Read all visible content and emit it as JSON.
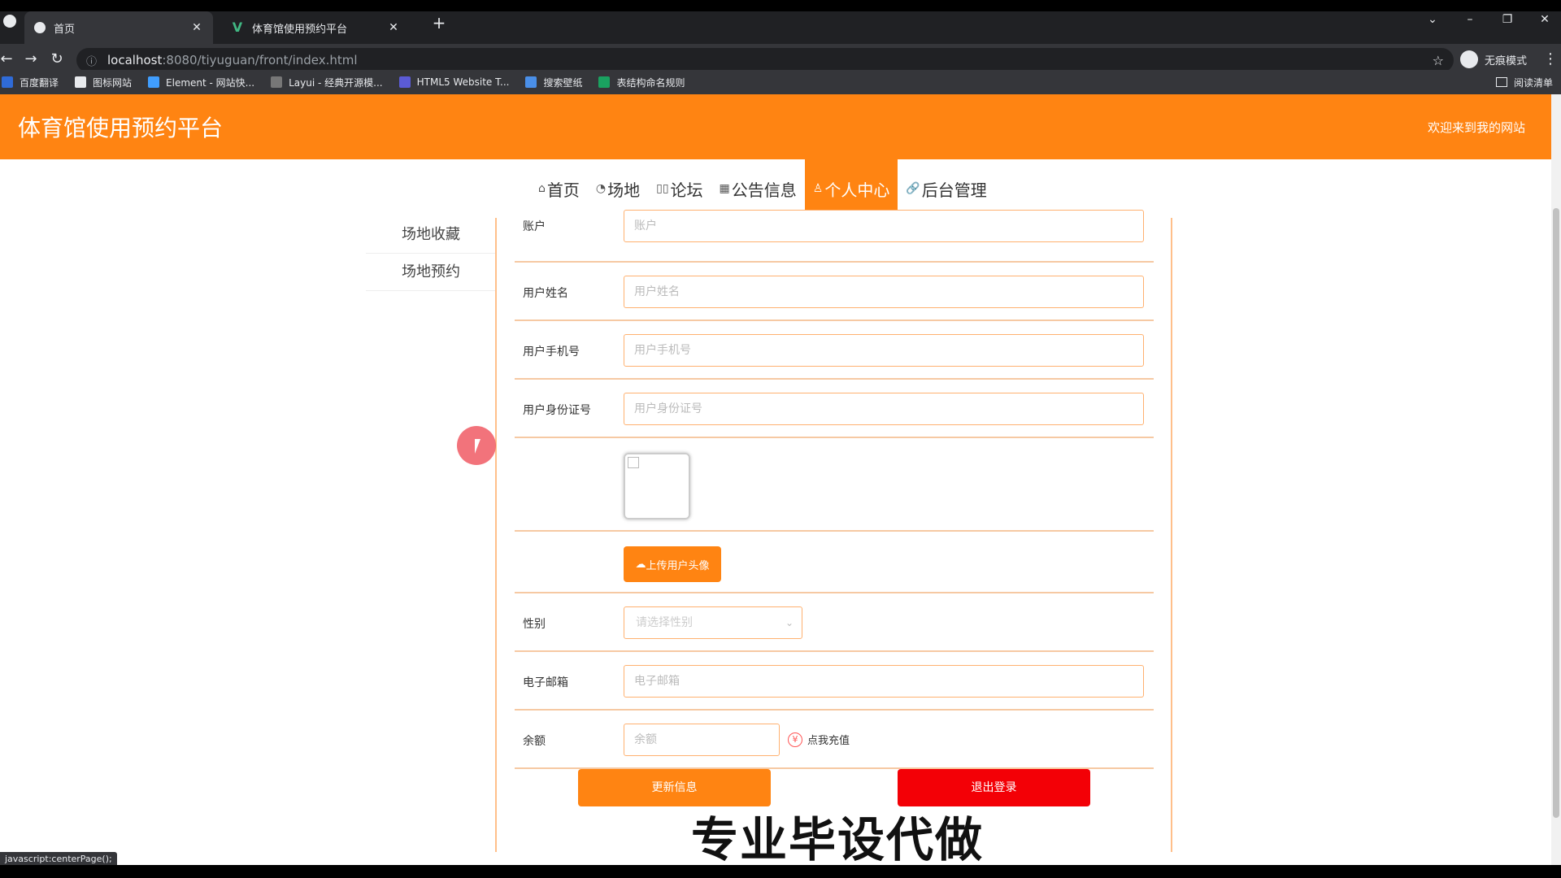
{
  "browser": {
    "tabs": [
      {
        "title": "首页",
        "close": "✕"
      },
      {
        "title": "体育馆使用预约平台",
        "close": "✕"
      }
    ],
    "new_tab": "+",
    "url_host": "localhost",
    "url_path": ":8080/tiyuguan/front/index.html",
    "incognito_label": "无痕模式",
    "bookmarks": [
      "百度翻译",
      "图标网站",
      "Element - 网站快...",
      "Layui - 经典开源模...",
      "HTML5 Website T...",
      "搜索壁纸",
      "表结构命名规则"
    ],
    "reading_list": "阅读清单",
    "status_text": "javascript:centerPage();"
  },
  "site": {
    "title": "体育馆使用预约平台",
    "welcome": "欢迎来到我的网站"
  },
  "nav": [
    {
      "label": "首页",
      "icon": "⌂"
    },
    {
      "label": "场地",
      "icon": "◔"
    },
    {
      "label": "论坛",
      "icon": "▯▯"
    },
    {
      "label": "公告信息",
      "icon": "▦"
    },
    {
      "label": "个人中心",
      "icon": "♙",
      "active": true
    },
    {
      "label": "后台管理",
      "icon": "🔗"
    }
  ],
  "sidebar": {
    "items": [
      "场地收藏",
      "场地预约"
    ]
  },
  "form": {
    "account": {
      "label": "账户",
      "placeholder": "账户"
    },
    "name": {
      "label": "用户姓名",
      "placeholder": "用户姓名"
    },
    "phone": {
      "label": "用户手机号",
      "placeholder": "用户手机号"
    },
    "idcard": {
      "label": "用户身份证号",
      "placeholder": "用户身份证号"
    },
    "upload_label": "上传用户头像",
    "gender": {
      "label": "性别",
      "placeholder": "请选择性别"
    },
    "email": {
      "label": "电子邮箱",
      "placeholder": "电子邮箱"
    },
    "balance": {
      "label": "余额",
      "placeholder": "余额"
    },
    "recharge_label": "点我充值",
    "update_label": "更新信息",
    "logout_label": "退出登录"
  },
  "overlay_caption": "专业毕设代做",
  "colors": {
    "primary": "#ff8412",
    "danger": "#f30006"
  }
}
